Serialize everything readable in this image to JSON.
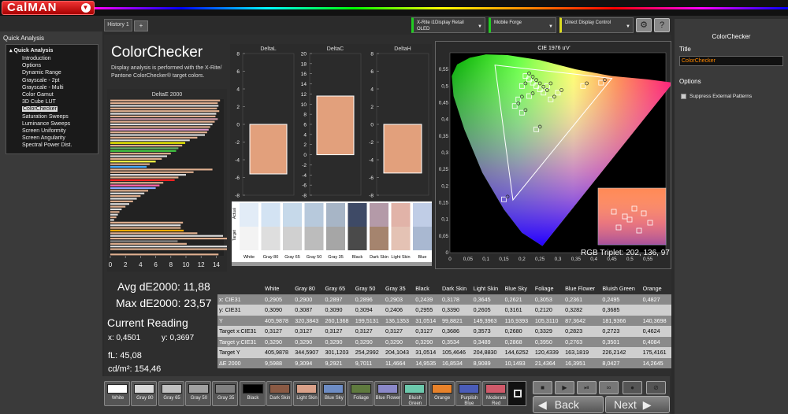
{
  "app": {
    "name": "CalMAN"
  },
  "tabs": {
    "history": "History 1",
    "add": "+"
  },
  "toolbar": {
    "meter": "X-Rite i1Display Retail\nOLED",
    "source": "Mobile Forge",
    "display": "Direct Display Control"
  },
  "left": {
    "panel_title": "Quick Analysis",
    "tree_root": "Quick Analysis",
    "items": [
      "Introduction",
      "Options",
      "Dynamic Range",
      "Grayscale - 2pt",
      "Grayscale - Multi",
      "Color Gamut",
      "3D Cube LUT",
      "ColorChecker",
      "Saturation Sweeps",
      "Luminance Sweeps",
      "Screen Uniformity",
      "Screen Angularity",
      "Spectral Power Dist."
    ],
    "selected_index": 7
  },
  "main": {
    "title": "ColorChecker",
    "description": "Display analysis is performed with the X-Rite/ Pantone ColorChecker® target colors.",
    "avg_de": "Avg dE2000: 11,88",
    "max_de": "Max dE2000: 23,57",
    "current_reading": "Current Reading",
    "x_reading": "x: 0,4501",
    "y_reading": "y: 0,3697",
    "fl": "fL: 45,08",
    "cdm2": "cd/m²: 154,46",
    "rgb_triplet": "RGB Triplet: 202, 136, 97",
    "swatch_row_actual": "Actual",
    "swatch_row_target": "Target"
  },
  "chart_data": [
    {
      "type": "bar",
      "title": "DeltaE 2000",
      "orientation": "horizontal",
      "xticks": [
        "0",
        "2",
        "4",
        "6",
        "8",
        "10",
        "12",
        "14"
      ],
      "xlim": [
        0,
        15
      ],
      "values": [
        14.5,
        14.2,
        14.3,
        14.1,
        14.4,
        14.0,
        13.9,
        14.2,
        13.8,
        13.5,
        13.2,
        13.0,
        12.8,
        12.5,
        11.5,
        10.5,
        9.9,
        9.5,
        9.0,
        8.7,
        8.0,
        7.5,
        6.8,
        6.0,
        5.2,
        4.8,
        13.5,
        11.0,
        10.0,
        9.0,
        8.5,
        7.0,
        6.5,
        6.0,
        5.0,
        4.5,
        4.0,
        3.5,
        3.0,
        2.5,
        2.0,
        1.5,
        1.2,
        1.0,
        0.8,
        0.5,
        9.6,
        9.3,
        9.3,
        9.7,
        11.5,
        14.9,
        16.9,
        8.9,
        10.1,
        21.4,
        16.4,
        8.0,
        14.3
      ],
      "colors": [
        "#e0b090",
        "#e0b090",
        "#ddd",
        "#e0b090",
        "#e0b090",
        "#ddd",
        "#e0b090",
        "#c9a",
        "#e0b090",
        "#ddd",
        "#e0b090",
        "#d9c",
        "#e0b090",
        "#ddd",
        "#e0b090",
        "#ddd",
        "#ff0",
        "#e0b090",
        "#6a6",
        "#4c4",
        "#e0b090",
        "#ddd",
        "#e0b090",
        "#ff4",
        "#e0b090",
        "#4af",
        "#e0b090",
        "#e0b090",
        "#ddd",
        "#e0b090",
        "#f22",
        "#e0b090",
        "#f6a",
        "#8af",
        "#e0b090",
        "#ddd",
        "#e0b090",
        "#ddd",
        "#e0b090",
        "#ddd",
        "#e0b090",
        "#ddd",
        "#e0b090",
        "#ddd",
        "#e0b090",
        "#ddd",
        "#e0b090",
        "#ddd",
        "#e0b090",
        "#fa0",
        "#e0b090",
        "#ddd",
        "#e0b090",
        "#888",
        "#e0b090",
        "#ddd",
        "#e0b090",
        "#222",
        "#e0b090"
      ]
    },
    {
      "type": "bar",
      "title": "DeltaL",
      "ylim": [
        -8,
        8
      ],
      "yticks": [
        "8",
        "6",
        "4",
        "2",
        "0",
        "-2",
        "-4",
        "-6",
        "-8"
      ],
      "values": [
        -5.6
      ]
    },
    {
      "type": "bar",
      "title": "DeltaC",
      "ylim": [
        -8,
        20
      ],
      "yticks": [
        "20",
        "18",
        "16",
        "14",
        "12",
        "10",
        "8",
        "6",
        "4",
        "2",
        "0",
        "-2",
        "-4",
        "-6",
        "-8"
      ],
      "values": [
        11.6
      ]
    },
    {
      "type": "bar",
      "title": "DeltaH",
      "ylim": [
        -8,
        8
      ],
      "yticks": [
        "8",
        "6",
        "4",
        "2",
        "0",
        "-2",
        "-4",
        "-6",
        "-8"
      ],
      "values": [
        -5.5
      ]
    },
    {
      "type": "scatter",
      "title": "CIE 1976 u'v'",
      "xticks": [
        "0",
        "0,05",
        "0,1",
        "0,15",
        "0,2",
        "0,25",
        "0,3",
        "0,35",
        "0,4",
        "0,45",
        "0,5",
        "0,55"
      ],
      "yticks": [
        "0,55",
        "0,5",
        "0,45",
        "0,4",
        "0,35",
        "0,3",
        "0,25",
        "0,2",
        "0,15",
        "0,1",
        "0,05",
        "0"
      ],
      "xlim": [
        0,
        0.6
      ],
      "ylim": [
        0,
        0.6
      ]
    }
  ],
  "swatches": {
    "labels": [
      "White",
      "Gray 80",
      "Gray 65",
      "Gray 50",
      "Gray 35",
      "Black",
      "Dark Skin",
      "Light Skin",
      "Blue"
    ],
    "actual": [
      "#e2ecf7",
      "#d3e3f3",
      "#c6d9ea",
      "#b7c9dc",
      "#a7b5c6",
      "#3e4a66",
      "#b49aa8",
      "#e1b3a8",
      "#c0cde6"
    ],
    "target": [
      "#f3f3f3",
      "#dedede",
      "#d0d0d0",
      "#bcbcbc",
      "#a6a6a6",
      "#4a4a4a",
      "#a5846e",
      "#e4c2b4",
      "#a9b8d1"
    ]
  },
  "table": {
    "columns": [
      "",
      "White",
      "Gray 80",
      "Gray 65",
      "Gray 50",
      "Gray 35",
      "Black",
      "Dark Skin",
      "Light Skin",
      "Blue Sky",
      "Foliage",
      "Blue Flower",
      "Bluish Green",
      "Orange"
    ],
    "rows": [
      [
        "x: CIE31",
        "0,2905",
        "0,2900",
        "0,2897",
        "0,2896",
        "0,2903",
        "0,2439",
        "0,3178",
        "0,3645",
        "0,2621",
        "0,3053",
        "0,2361",
        "0,2495",
        "0,4827"
      ],
      [
        "y: CIE31",
        "0,3090",
        "0,3087",
        "0,3090",
        "0,3094",
        "0,2406",
        "0,2955",
        "0,3390",
        "0,2605",
        "0,3161",
        "0,2120",
        "0,3282",
        "0,3685",
        ""
      ],
      [
        "Y",
        "405,9878",
        "320,3843",
        "260,1368",
        "199,5131",
        "136,1353",
        "31,0514",
        "99,8821",
        "149,3963",
        "116,9393",
        "105,3110",
        "87,3642",
        "181,9366",
        "140,3698"
      ],
      [
        "Target x:CIE31",
        "0,3127",
        "0,3127",
        "0,3127",
        "0,3127",
        "0,3127",
        "0,3127",
        "0,3686",
        "0,3573",
        "0,2680",
        "0,3329",
        "0,2823",
        "0,2723",
        "0,4624"
      ],
      [
        "Target y:CIE31",
        "0,3290",
        "0,3290",
        "0,3290",
        "0,3290",
        "0,3290",
        "0,3290",
        "0,3534",
        "0,3489",
        "0,2868",
        "0,3950",
        "0,2763",
        "0,3501",
        "0,4084"
      ],
      [
        "Target Y",
        "405,9878",
        "344,5907",
        "301,1203",
        "254,2992",
        "204,1043",
        "31,0514",
        "105,4646",
        "204,8830",
        "144,6252",
        "120,4339",
        "163,1819",
        "226,2142",
        "175,4161"
      ],
      [
        "ΔE 2000",
        "9,5988",
        "9,3094",
        "9,2921",
        "9,7011",
        "11,4664",
        "14,9535",
        "16,8534",
        "8,9089",
        "10,1493",
        "21,4364",
        "16,3951",
        "8,0427",
        "14,2645"
      ]
    ]
  },
  "patches": [
    {
      "label": "White",
      "color": "#ffffff"
    },
    {
      "label": "Gray 80",
      "color": "#d9d9d9"
    },
    {
      "label": "Gray 65",
      "color": "#bfbfbf"
    },
    {
      "label": "Gray 50",
      "color": "#a0a0a0"
    },
    {
      "label": "Gray 35",
      "color": "#808080"
    },
    {
      "label": "Black",
      "color": "#000000"
    },
    {
      "label": "Dark Skin",
      "color": "#8a5a44"
    },
    {
      "label": "Light Skin",
      "color": "#d9a088"
    },
    {
      "label": "Blue Sky",
      "color": "#6d8cc4"
    },
    {
      "label": "Foliage",
      "color": "#5f7a3e"
    },
    {
      "label": "Blue Flower",
      "color": "#8a88c8"
    },
    {
      "label": "Bluish Green",
      "color": "#6cc8ac"
    },
    {
      "label": "Orange",
      "color": "#e8822a"
    },
    {
      "label": "Purplish Blue",
      "color": "#4a5cb8"
    },
    {
      "label": "Moderate Red",
      "color": "#d05a6a"
    }
  ],
  "nav": {
    "back": "Back",
    "next": "Next"
  },
  "right": {
    "header": "ColorChecker",
    "title_label": "Title",
    "title_value": "ColorChecker",
    "options_label": "Options",
    "option1": "Suppress External Patterns"
  }
}
